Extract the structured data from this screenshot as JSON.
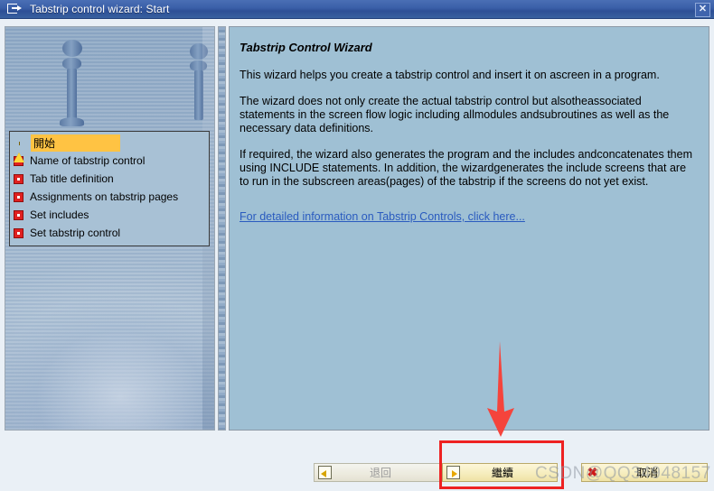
{
  "window": {
    "title": "Tabstrip control wizard: Start",
    "title_icon": "window-arrow-icon",
    "close_label": "✕",
    "accent_title_color": "#2d4f96",
    "panel_bg_color": "#9fc0d4",
    "highlight_color": "#ffc343",
    "annotation_color": "#ee2222"
  },
  "sidebar": {
    "items": [
      {
        "label": "開始",
        "icon": "warning-triangle-icon",
        "active": true
      },
      {
        "label": "Name of tabstrip control",
        "icon": "red-square-icon",
        "active": false
      },
      {
        "label": "Tab title definition",
        "icon": "red-square-icon",
        "active": false
      },
      {
        "label": "Assignments on tabstrip pages",
        "icon": "red-square-icon",
        "active": false
      },
      {
        "label": "Set includes",
        "icon": "red-square-icon",
        "active": false
      },
      {
        "label": "Set tabstrip control",
        "icon": "red-square-icon",
        "active": false
      }
    ]
  },
  "content": {
    "heading": "Tabstrip Control Wizard",
    "paragraphs": [
      "This wizard helps you create a tabstrip control and insert it on ascreen in a program.",
      "The wizard does not only create the actual tabstrip control but alsotheassociated statements in the screen flow logic including allmodules andsubroutines as well as the necessary data definitions.",
      "If required, the wizard also generates the program and the includes andconcatenates them using INCLUDE statements. In addition, the wizardgenerates the include screens that are to run in the subscreen areas(pages) of the tabstrip if the screens do not yet exist."
    ],
    "link_text": "For detailed information on Tabstrip Controls, click here..."
  },
  "footer": {
    "buttons": [
      {
        "label": "退回",
        "icon": "back-arrow-icon",
        "disabled": true
      },
      {
        "label": "繼續",
        "icon": "next-arrow-icon",
        "disabled": false
      },
      {
        "label": "取消",
        "icon": "cancel-x-icon",
        "disabled": false
      }
    ]
  },
  "annotations": {
    "arrow": "red-down-arrow",
    "highlight_box": "red-rectangle-around-continue-button",
    "watermark": "CSDN@QQ34948157"
  }
}
